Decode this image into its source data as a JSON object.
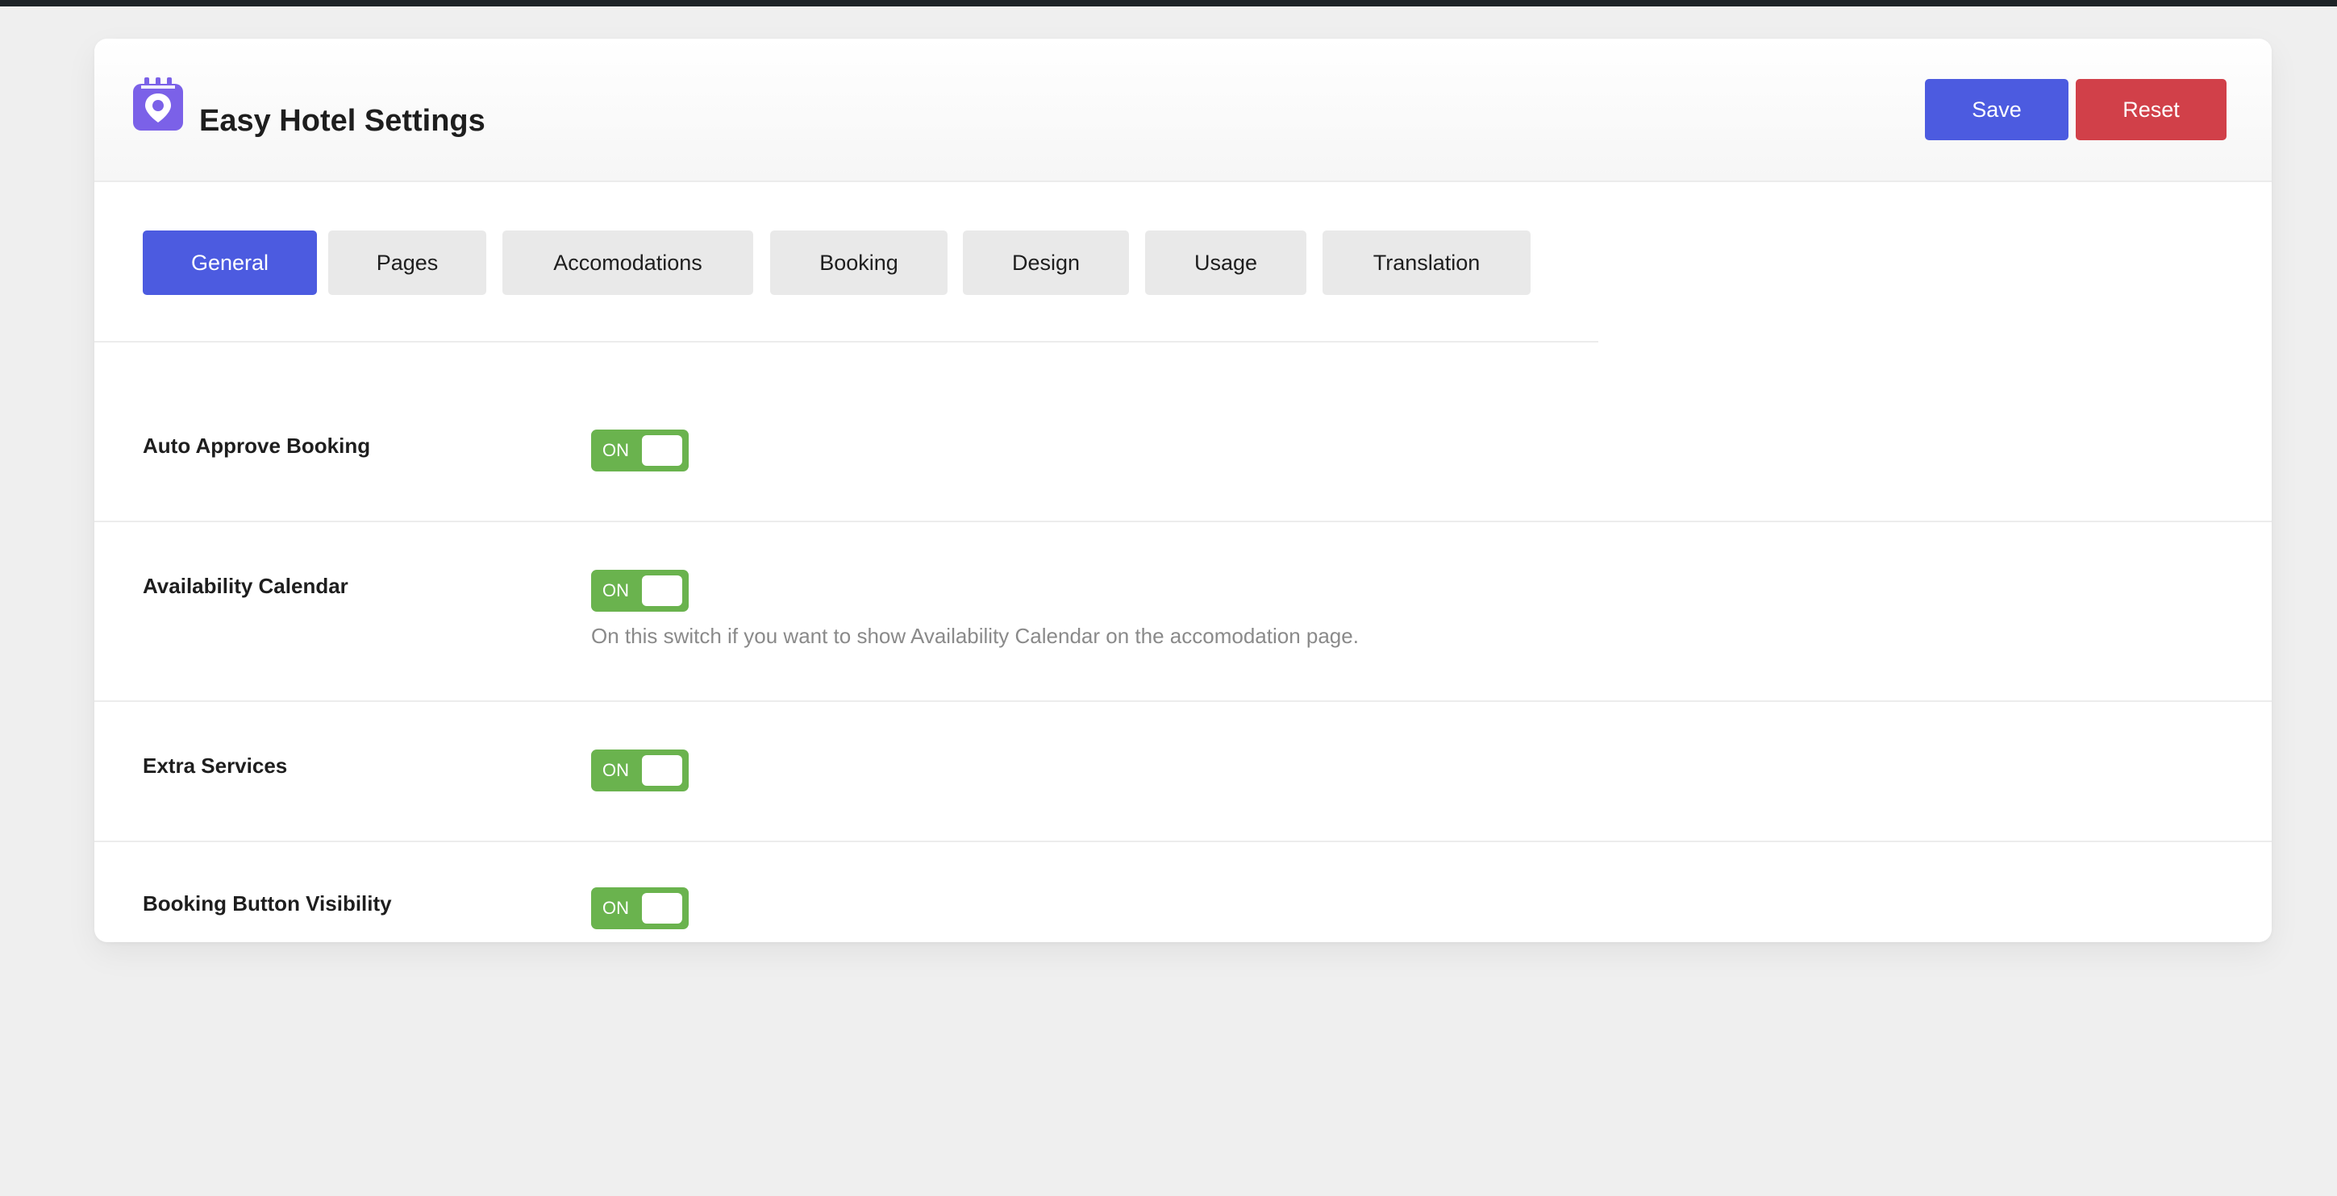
{
  "header": {
    "title": "Easy Hotel Settings",
    "logo_icon": "hotel-pin-calendar-icon",
    "save_label": "Save",
    "reset_label": "Reset",
    "colors": {
      "save": "#4c5be0",
      "reset": "#d14049",
      "logo": "#7b61e8"
    }
  },
  "tabs": [
    {
      "label": "General",
      "active": true
    },
    {
      "label": "Pages",
      "active": false
    },
    {
      "label": "Accomodations",
      "active": false
    },
    {
      "label": "Booking",
      "active": false
    },
    {
      "label": "Design",
      "active": false
    },
    {
      "label": "Usage",
      "active": false
    },
    {
      "label": "Translation",
      "active": false
    }
  ],
  "settings": [
    {
      "label": "Auto Approve Booking",
      "toggle": "ON",
      "enabled": true,
      "description": ""
    },
    {
      "label": "Availability Calendar",
      "toggle": "ON",
      "enabled": true,
      "description": "On this switch if you want to show Availability Calendar on the accomodation page."
    },
    {
      "label": "Extra Services",
      "toggle": "ON",
      "enabled": true,
      "description": ""
    },
    {
      "label": "Booking Button Visibility",
      "toggle": "ON",
      "enabled": true,
      "description": ""
    }
  ],
  "colors": {
    "accent": "#4c5be0",
    "toggle_on": "#6ab34e"
  }
}
